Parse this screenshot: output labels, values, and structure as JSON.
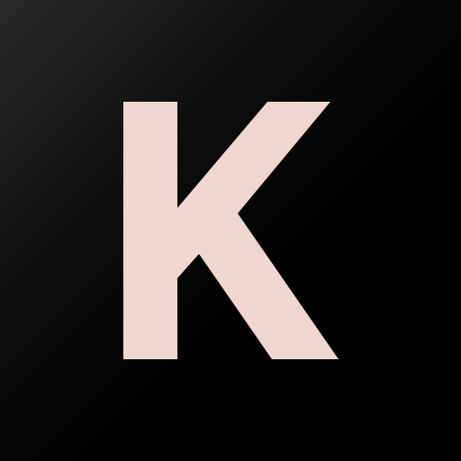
{
  "logo": {
    "letter": "K",
    "icon": "k-letter-logo",
    "colors": {
      "letter": "#EFD6CF",
      "background_dark": "#000000",
      "background_highlight": "#2A2A2A"
    }
  }
}
